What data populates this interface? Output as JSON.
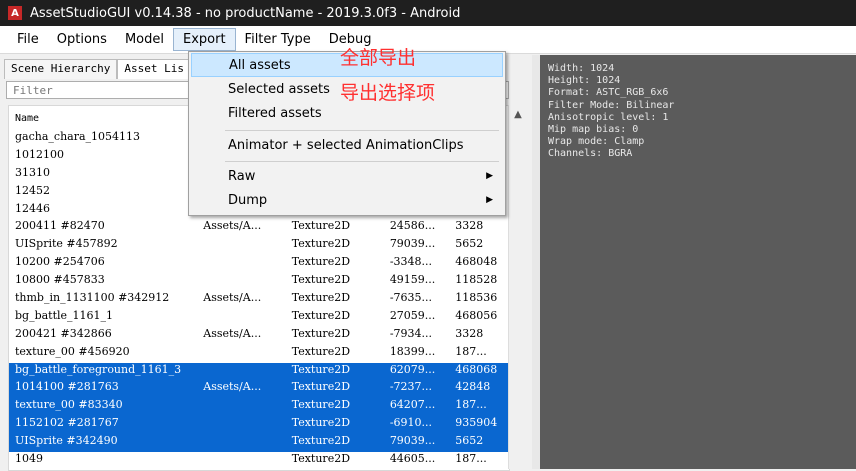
{
  "window": {
    "title": "AssetStudioGUI v0.14.38 - no productName - 2019.3.0f3 - Android",
    "icon_text": "A"
  },
  "menu": [
    "File",
    "Options",
    "Model",
    "Export",
    "Filter Type",
    "Debug"
  ],
  "tabs": [
    "Scene Hierarchy",
    "Asset Lis"
  ],
  "filter_placeholder": "Filter",
  "list_header": "Name",
  "rows": [
    [
      "gacha_chara_1054113",
      "",
      "",
      "",
      ""
    ],
    [
      "1012100",
      "",
      "",
      "",
      ""
    ],
    [
      "31310",
      "",
      "",
      "",
      ""
    ],
    [
      "12452",
      "",
      "",
      "",
      ""
    ],
    [
      "12446",
      "",
      "",
      "",
      ""
    ],
    [
      "200411 #82470",
      "Assets/A...",
      "Texture2D",
      "24586...",
      "3328"
    ],
    [
      "UISprite #457892",
      "",
      "Texture2D",
      "79039...",
      "5652"
    ],
    [
      "10200 #254706",
      "",
      "Texture2D",
      "-3348...",
      "468048"
    ],
    [
      "10800 #457833",
      "",
      "Texture2D",
      "49159...",
      "118528"
    ],
    [
      "thmb_in_1131100 #342912",
      "Assets/A...",
      "Texture2D",
      "-7635...",
      "118536"
    ],
    [
      "bg_battle_1161_1",
      "",
      "Texture2D",
      "27059...",
      "468056"
    ],
    [
      "200421 #342866",
      "Assets/A...",
      "Texture2D",
      "-7934...",
      "3328"
    ],
    [
      "texture_00 #456920",
      "",
      "Texture2D",
      "18399...",
      "187..."
    ],
    [
      "bg_battle_foreground_1161_3",
      "",
      "Texture2D",
      "62079...",
      "468068"
    ],
    [
      "1014100 #281763",
      "Assets/A...",
      "Texture2D",
      "-7237...",
      "42848"
    ],
    [
      "texture_00 #83340",
      "",
      "Texture2D",
      "64207...",
      "187..."
    ],
    [
      "1152102 #281767",
      "",
      "Texture2D",
      "-6910...",
      "935904"
    ],
    [
      "UISprite #342490",
      "",
      "Texture2D",
      "79039...",
      "5652"
    ],
    [
      "1049",
      "",
      "Texture2D",
      "44605...",
      "187..."
    ]
  ],
  "selected_rows": [
    13,
    14,
    15,
    16,
    17
  ],
  "info": "Width: 1024\nHeight: 1024\nFormat: ASTC_RGB_6x6\nFilter Mode: Bilinear\nAnisotropic level: 1\nMip map bias: 0\nWrap mode: Clamp\nChannels: BGRA",
  "export_menu": {
    "all_assets": "All assets",
    "selected_assets": "Selected assets",
    "filtered_assets": "Filtered assets",
    "animator": "Animator + selected AnimationClips",
    "raw": "Raw",
    "dump": "Dump",
    "submenu_arrow": "▶"
  },
  "annotations": {
    "line1": "全部导出",
    "line2": "导出选择项",
    "color": "#ff3030"
  },
  "colors": {
    "selection": "#0a67d0",
    "menu_highlight": "#cce8ff"
  }
}
